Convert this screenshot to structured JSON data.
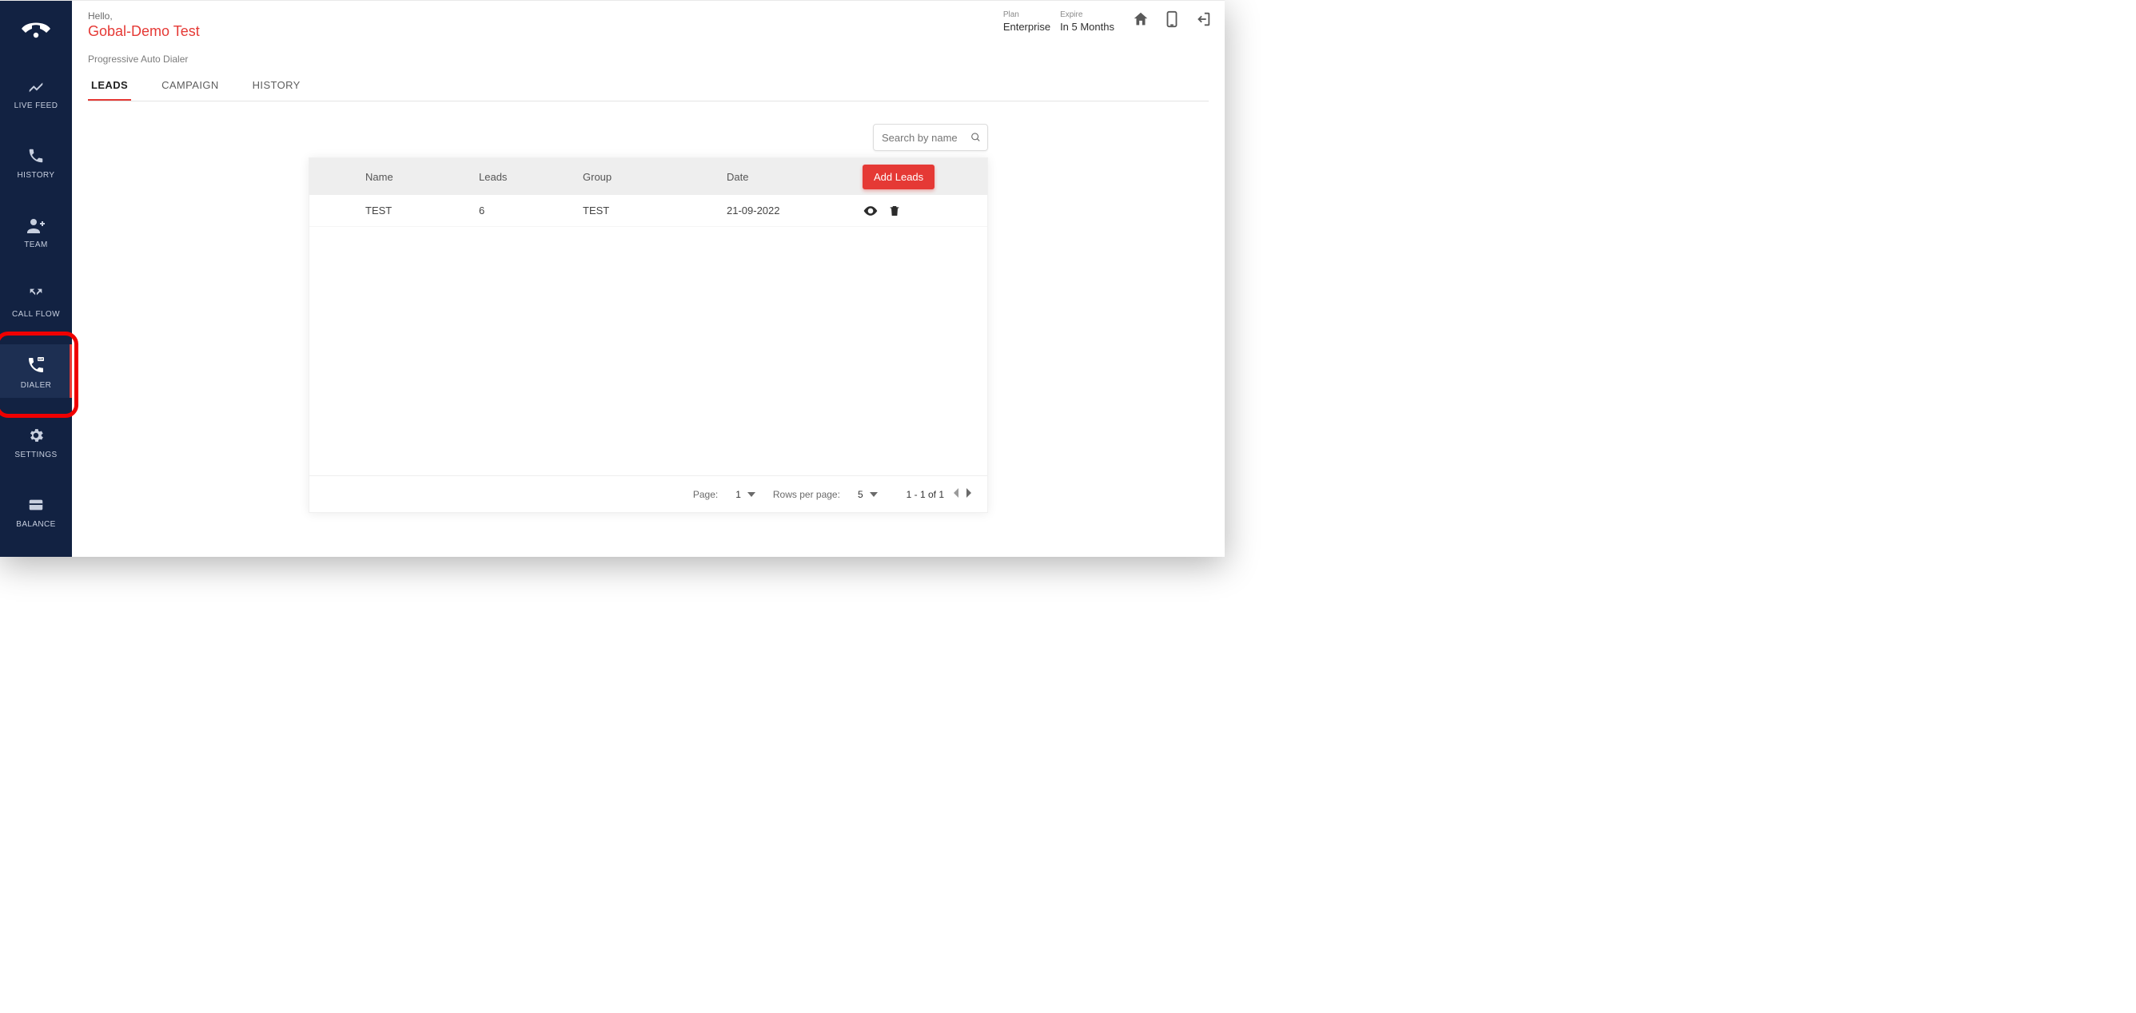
{
  "sidebar": {
    "items": [
      {
        "label": "LIVE FEED",
        "icon": "chart-line-icon"
      },
      {
        "label": "HISTORY",
        "icon": "phone-icon"
      },
      {
        "label": "TEAM",
        "icon": "person-add-icon"
      },
      {
        "label": "CALL FLOW",
        "icon": "call-split-icon"
      },
      {
        "label": "DIALER",
        "icon": "sip-phone-icon"
      },
      {
        "label": "SETTINGS",
        "icon": "gear-icon"
      },
      {
        "label": "BALANCE",
        "icon": "credit-card-icon"
      }
    ],
    "selected_index": 4
  },
  "header": {
    "hello": "Hello,",
    "username": "Gobal-Demo Test",
    "plan_label": "Plan",
    "plan_value": "Enterprise",
    "expire_label": "Expire",
    "expire_value": "In 5 Months"
  },
  "breadcrumb": "Progressive Auto Dialer",
  "tabs": [
    "LEADS",
    "CAMPAIGN",
    "HISTORY"
  ],
  "active_tab_index": 0,
  "search": {
    "placeholder": "Search by name"
  },
  "table": {
    "columns": [
      "Name",
      "Leads",
      "Group",
      "Date"
    ],
    "add_button": "Add Leads",
    "rows": [
      {
        "name": "TEST",
        "leads": "6",
        "group": "TEST",
        "date": "21-09-2022"
      }
    ]
  },
  "pagination": {
    "page_label": "Page:",
    "page_value": "1",
    "rows_label": "Rows per page:",
    "rows_value": "5",
    "range": "1 - 1 of 1"
  }
}
